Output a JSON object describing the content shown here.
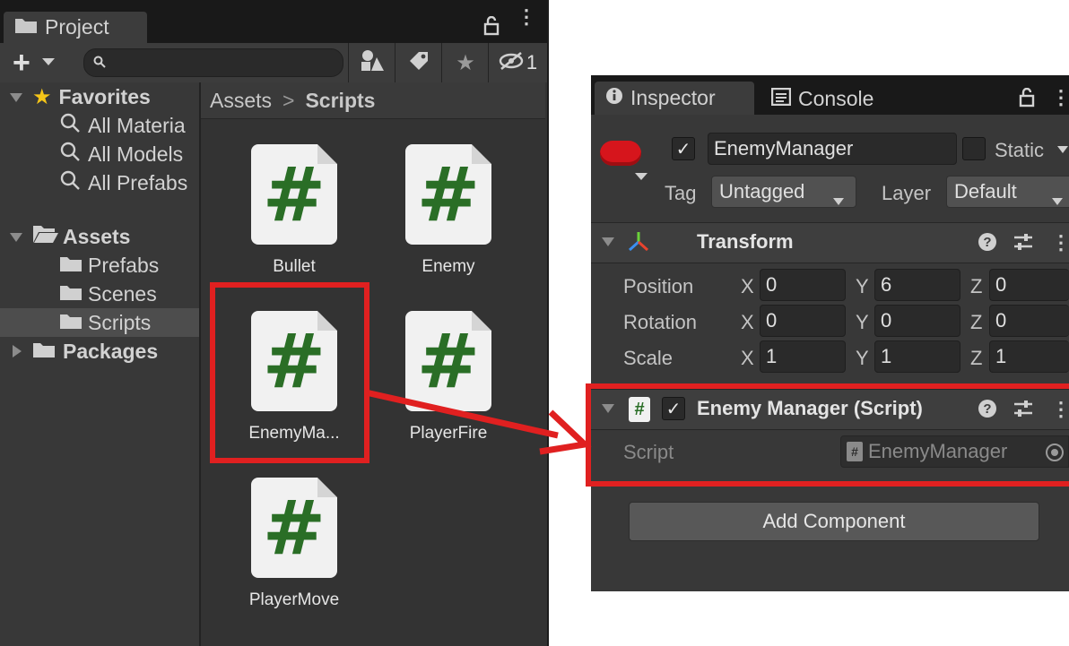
{
  "project": {
    "tab_label": "Project",
    "lock_icon": "lock-icon",
    "menu_icon": "kebab-menu-icon",
    "add_button": "+",
    "search_placeholder": "",
    "hidden_count": "1",
    "tree": {
      "favorites": "Favorites",
      "all_materials": "All Materia",
      "all_models": "All Models",
      "all_prefabs": "All Prefabs",
      "assets": "Assets",
      "prefabs": "Prefabs",
      "scenes": "Scenes",
      "scripts": "Scripts",
      "packages": "Packages"
    },
    "breadcrumb": {
      "root": "Assets",
      "separator": ">",
      "current": "Scripts"
    },
    "files": [
      {
        "name": "Bullet",
        "glyph": "#"
      },
      {
        "name": "Enemy",
        "glyph": "#"
      },
      {
        "name": "EnemyMa...",
        "glyph": "#"
      },
      {
        "name": "PlayerFire",
        "glyph": "#"
      },
      {
        "name": "PlayerMove",
        "glyph": "#"
      }
    ]
  },
  "inspector": {
    "tab_inspector": "Inspector",
    "tab_console": "Console",
    "object_name": "EnemyManager",
    "active_checked": true,
    "static_label": "Static",
    "tag_label": "Tag",
    "tag_value": "Untagged",
    "layer_label": "Layer",
    "layer_value": "Default",
    "transform": {
      "title": "Transform",
      "rows": [
        {
          "label": "Position",
          "x": "0",
          "y": "6",
          "z": "0"
        },
        {
          "label": "Rotation",
          "x": "0",
          "y": "0",
          "z": "0"
        },
        {
          "label": "Scale",
          "x": "1",
          "y": "1",
          "z": "1"
        }
      ],
      "axis_x": "X",
      "axis_y": "Y",
      "axis_z": "Z"
    },
    "script_component": {
      "title": "Enemy Manager (Script)",
      "script_label": "Script",
      "script_value": "EnemyManager",
      "hash": "#"
    },
    "add_component": "Add Component"
  },
  "colors": {
    "highlight_red": "#e02020",
    "script_green": "#2a6e26",
    "panel_dark": "#282828"
  }
}
